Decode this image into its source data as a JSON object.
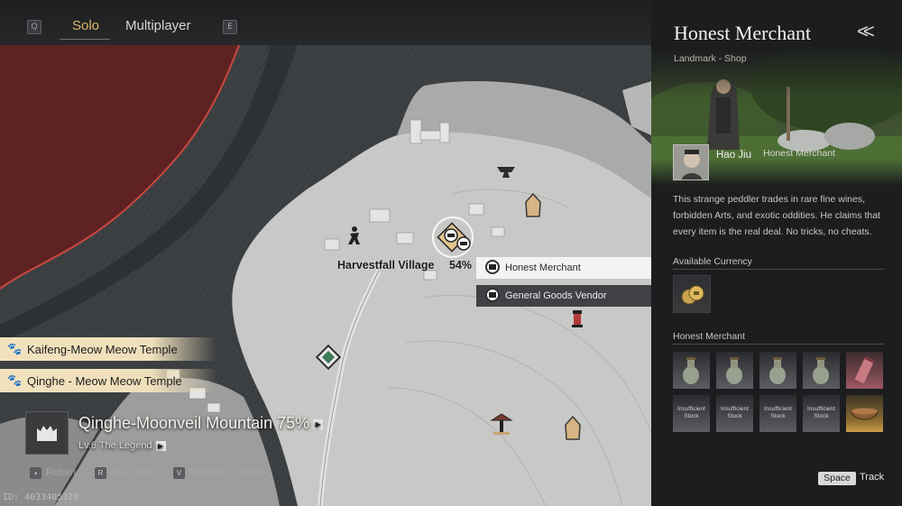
{
  "topbar": {
    "key_left": "Q",
    "key_right": "E",
    "tabs": [
      {
        "label": "Solo",
        "active": true
      },
      {
        "label": "Multiplayer",
        "active": false
      }
    ]
  },
  "map": {
    "village_name": "Harvestfall Village",
    "village_progress": "54%",
    "poi_tags": [
      {
        "label": "Honest Merchant",
        "style": "light"
      },
      {
        "label": "General Goods Vendor",
        "style": "dark"
      }
    ],
    "temple_tags": [
      {
        "label": "Kaifeng-Meow Meow Temple"
      },
      {
        "label": "Qinghe - Meow Meow Temple"
      }
    ],
    "region": {
      "name": "Qinghe-Moonveil Mountain 75%",
      "level": "Lv.6 The Legend"
    },
    "hints": [
      {
        "key": "",
        "label": "Return"
      },
      {
        "key": "R",
        "label": "POI Filter"
      },
      {
        "key": "V",
        "label": "Material Tracking"
      }
    ],
    "player_id": "ID: 4033405329"
  },
  "panel": {
    "title": "Honest Merchant",
    "subtitle": "Landmark - Shop",
    "npc_name": "Hao Jiu",
    "npc_role": "Honest Merchant",
    "description": "This strange peddler trades in rare fine wines, forbidden Arts, and exotic oddities. He claims that every item is the real deal. No tricks, no cheats.",
    "currency_heading": "Available Currency",
    "shop_heading": "Honest Merchant",
    "items_row1": [
      {
        "icon": "vase-icon",
        "tier": "normal"
      },
      {
        "icon": "vase-icon",
        "tier": "normal"
      },
      {
        "icon": "vase-icon",
        "tier": "normal"
      },
      {
        "icon": "vase-icon",
        "tier": "normal"
      },
      {
        "icon": "scroll-icon",
        "tier": "rare"
      }
    ],
    "items_row2": [
      {
        "label": "Insufficient Stock",
        "tier": "normal"
      },
      {
        "label": "Insufficient Stock",
        "tier": "normal"
      },
      {
        "label": "Insufficient Stock",
        "tier": "normal"
      },
      {
        "label": "Insufficient Stock",
        "tier": "normal"
      },
      {
        "icon": "bowl-icon",
        "tier": "legendary"
      }
    ],
    "space_key": "Space",
    "track_label": "Track"
  }
}
